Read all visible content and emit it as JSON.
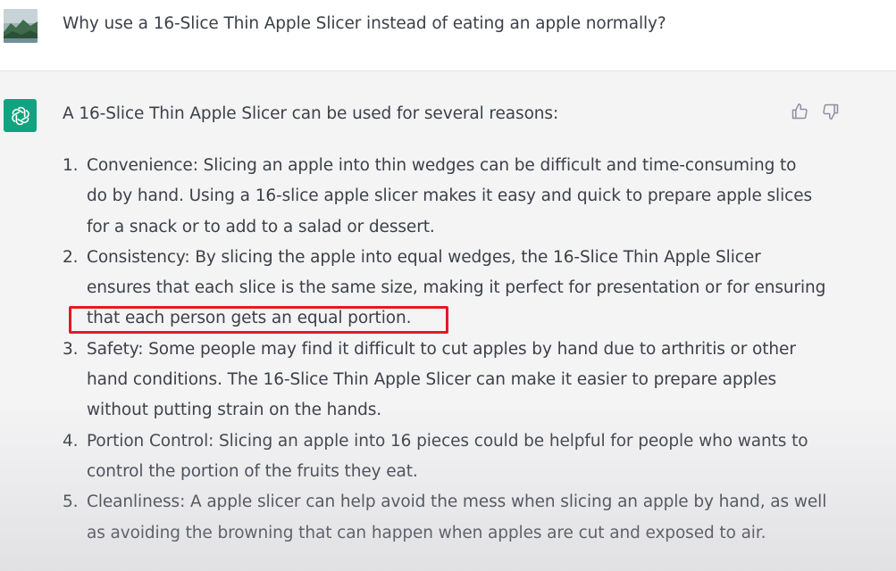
{
  "conversation": {
    "user_message": "Why use a 16-Slice Thin Apple Slicer instead of eating an apple normally?",
    "assistant_intro": "A 16-Slice Thin Apple Slicer can be used for several reasons:",
    "items": [
      {
        "number": "1.",
        "lines": [
          "Convenience: Slicing an apple into thin wedges can be difficult and time-consuming to",
          "do by hand. Using a 16-slice apple slicer makes it easy and quick to prepare apple slices",
          "for a snack or to add to a salad or dessert."
        ]
      },
      {
        "number": "2.",
        "lines": [
          "Consistency: By slicing the apple into equal wedges, the 16-Slice Thin Apple Slicer",
          "ensures that each slice is the same size, making it perfect for presentation or for ensuring",
          "that each person gets an equal portion."
        ]
      },
      {
        "number": "3.",
        "lines": [
          "Safety: Some people may find it difficult to cut apples by hand due to arthritis or other",
          "hand conditions. The 16-Slice Thin Apple Slicer can make it easier to prepare apples",
          "without putting strain on the hands."
        ]
      },
      {
        "number": "4.",
        "lines": [
          "Portion Control: Slicing an apple into 16 pieces could be helpful for people who wants to",
          "control the portion of the fruits they eat."
        ]
      },
      {
        "number": "5.",
        "lines": [
          "Cleanliness: A apple slicer can help avoid the mess when slicing an apple by hand, as well",
          "as avoiding the browning that can happen when apples are cut and exposed to air."
        ]
      }
    ]
  },
  "icons": {
    "user_avatar": "landscape-avatar-icon",
    "assistant_avatar": "openai-logo-icon",
    "feedback_up": "thumbs-up-icon",
    "feedback_down": "thumbs-down-icon"
  },
  "colors": {
    "assistant_brand": "#10a37f",
    "highlight_border": "#e01b24",
    "user_row_bg": "#ffffff",
    "assistant_row_bg": "#f4f4f5"
  }
}
